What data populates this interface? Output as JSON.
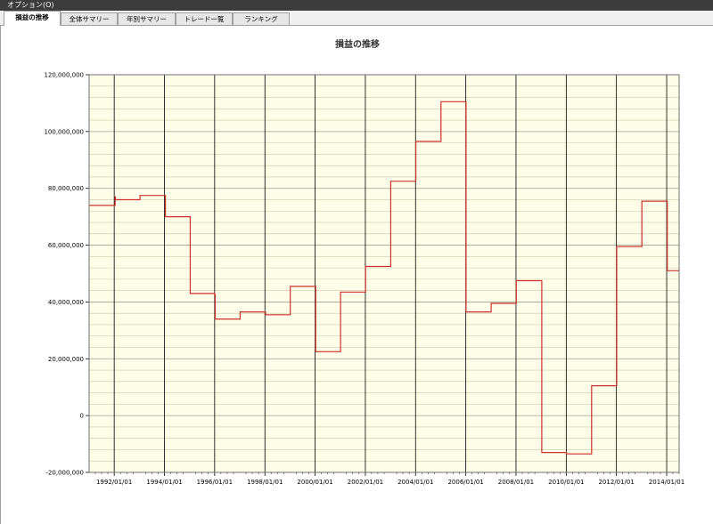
{
  "menu": {
    "options_label": "オプション(O)"
  },
  "tabs": [
    {
      "label": "損益の推移",
      "active": true
    },
    {
      "label": "全体サマリー",
      "active": false
    },
    {
      "label": "年別サマリー",
      "active": false
    },
    {
      "label": "トレード一覧",
      "active": false
    },
    {
      "label": "ランキング",
      "active": false
    }
  ],
  "colors": {
    "plot_background": "#fdfde8",
    "line": "#d03030",
    "major_grid": "#000000",
    "minor_grid": "#c8c8a8"
  },
  "chart_data": {
    "type": "line",
    "title": "損益の推移",
    "ylim": [
      -20000000,
      120000000
    ],
    "xlim": [
      "1991/01/01",
      "2014/07/01"
    ],
    "y_ticks": [
      -20000000,
      0,
      20000000,
      40000000,
      60000000,
      80000000,
      100000000,
      120000000
    ],
    "y_tick_labels": [
      "-20,000,000",
      "0",
      "20,000,000",
      "40,000,000",
      "60,000,000",
      "80,000,000",
      "100,000,000",
      "120,000,000"
    ],
    "x_ticks": [
      "1992/01/01",
      "1994/01/01",
      "1996/01/01",
      "1998/01/01",
      "2000/01/01",
      "2002/01/01",
      "2004/01/01",
      "2006/01/01",
      "2008/01/01",
      "2010/01/01",
      "2012/01/01",
      "2014/01/01"
    ],
    "grid": true,
    "series": [
      {
        "points": [
          [
            "1991/01/01",
            74000000
          ],
          [
            "1992/01/01",
            74000000
          ],
          [
            "1992/01/15",
            77000000
          ],
          [
            "1992/01/20",
            76000000
          ],
          [
            "1993/01/01",
            76000000
          ],
          [
            "1993/01/10",
            77500000
          ],
          [
            "1994/01/01",
            77500000
          ],
          [
            "1994/01/15",
            70000000
          ],
          [
            "1995/01/01",
            70000000
          ],
          [
            "1995/01/10",
            43000000
          ],
          [
            "1996/01/01",
            42500000
          ],
          [
            "1996/01/10",
            34000000
          ],
          [
            "1997/01/01",
            34000000
          ],
          [
            "1997/01/05",
            36500000
          ],
          [
            "1998/01/01",
            36500000
          ],
          [
            "1998/01/10",
            35500000
          ],
          [
            "1999/01/01",
            35500000
          ],
          [
            "1999/01/05",
            45500000
          ],
          [
            "2000/01/01",
            45500000
          ],
          [
            "2000/01/10",
            22500000
          ],
          [
            "2001/01/01",
            22500000
          ],
          [
            "2001/01/05",
            43500000
          ],
          [
            "2002/01/01",
            43500000
          ],
          [
            "2002/01/05",
            52500000
          ],
          [
            "2003/01/01",
            52500000
          ],
          [
            "2003/01/05",
            82500000
          ],
          [
            "2004/01/01",
            82500000
          ],
          [
            "2004/01/05",
            96500000
          ],
          [
            "2005/01/01",
            96500000
          ],
          [
            "2005/01/05",
            110500000
          ],
          [
            "2006/01/01",
            110500000
          ],
          [
            "2006/01/05",
            36500000
          ],
          [
            "2007/01/01",
            36500000
          ],
          [
            "2007/01/05",
            39500000
          ],
          [
            "2008/01/01",
            39500000
          ],
          [
            "2008/01/05",
            47500000
          ],
          [
            "2009/01/01",
            47500000
          ],
          [
            "2009/01/10",
            -13000000
          ],
          [
            "2010/01/01",
            -13000000
          ],
          [
            "2010/01/05",
            -13500000
          ],
          [
            "2011/01/01",
            -13500000
          ],
          [
            "2011/01/05",
            10500000
          ],
          [
            "2012/01/01",
            10500000
          ],
          [
            "2012/01/05",
            59500000
          ],
          [
            "2013/01/01",
            59500000
          ],
          [
            "2013/01/05",
            75500000
          ],
          [
            "2014/01/01",
            75500000
          ],
          [
            "2014/01/10",
            51000000
          ],
          [
            "2014/07/01",
            51000000
          ]
        ]
      }
    ]
  }
}
